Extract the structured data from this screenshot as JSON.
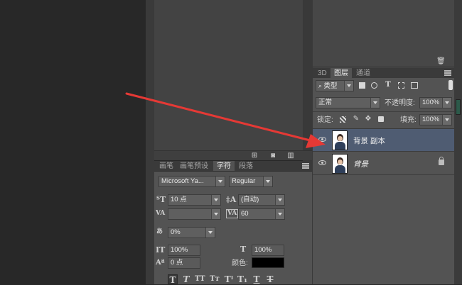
{
  "layers_panel": {
    "tabs": [
      "3D",
      "图层",
      "通道"
    ],
    "active_tab": "图层",
    "filter_kind": "类型",
    "blend_mode": "正常",
    "opacity_label": "不透明度:",
    "opacity_value": "100%",
    "lock_label": "锁定:",
    "fill_label": "填充:",
    "fill_value": "100%",
    "layers": [
      {
        "name": "背景 副本",
        "selected": true,
        "locked": false
      },
      {
        "name": "背景",
        "selected": false,
        "locked": true
      }
    ]
  },
  "char_panel": {
    "tabs": [
      "画笔",
      "画笔预设",
      "字符",
      "段落"
    ],
    "active_tab": "字符",
    "font_family": "Microsoft Ya...",
    "font_style": "Regular",
    "font_size": "10 点",
    "leading": "(自动)",
    "kerning": "",
    "tracking": "60",
    "tsume": "0%",
    "vertical_scale": "100%",
    "horizontal_scale": "100%",
    "baseline_shift": "0 点",
    "color_label": "颜色:",
    "color_value": "#000000"
  },
  "annotation": {
    "arrow_color": "#e53935"
  }
}
